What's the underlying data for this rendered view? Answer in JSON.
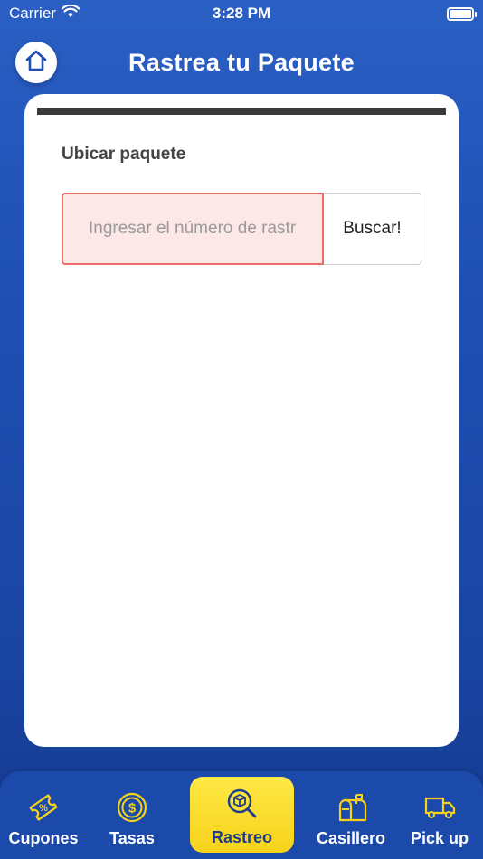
{
  "status_bar": {
    "carrier": "Carrier",
    "time": "3:28 PM"
  },
  "header": {
    "title": "Rastrea tu Paquete"
  },
  "tracking": {
    "label": "Ubicar paquete",
    "input_value": "",
    "input_placeholder": "Ingresar el número de rastreo",
    "button_label": "Buscar!"
  },
  "tabs": [
    {
      "label": "Cupones",
      "icon": "coupon-icon",
      "active": false
    },
    {
      "label": "Tasas",
      "icon": "dollar-coin-icon",
      "active": false
    },
    {
      "label": "Rastreo",
      "icon": "package-search-icon",
      "active": true
    },
    {
      "label": "Casillero",
      "icon": "mailbox-icon",
      "active": false
    },
    {
      "label": "Pick up",
      "icon": "truck-icon",
      "active": false
    }
  ],
  "colors": {
    "background": "#1f4fb3",
    "tab_active": "#f6d21a",
    "tab_icon": "#f6d21a",
    "input_error_border": "#ee6b6b",
    "input_error_bg": "#fde8e8"
  }
}
